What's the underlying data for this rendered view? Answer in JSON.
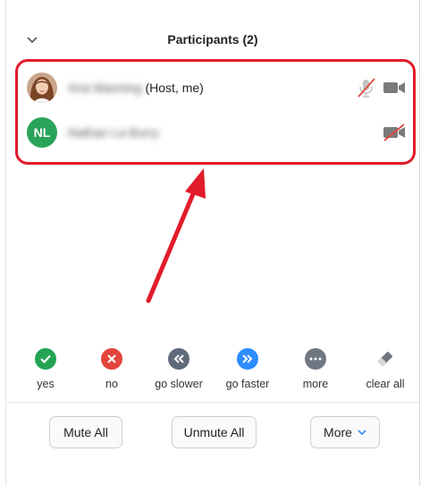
{
  "header": {
    "title": "Participants (2)"
  },
  "participants": [
    {
      "name": "Aria Manning",
      "suffix": "(Host, me)",
      "avatar": "photo"
    },
    {
      "name": "Nathan La Burry",
      "suffix": "",
      "initials": "NL",
      "avatar_color": "#2aa35a"
    }
  ],
  "reactions": [
    {
      "label": "yes",
      "color": "#23a455",
      "icon": "check-icon"
    },
    {
      "label": "no",
      "color": "#e2463c",
      "icon": "x-icon"
    },
    {
      "label": "go slower",
      "color": "#5f6b7a",
      "icon": "rewind-icon"
    },
    {
      "label": "go faster",
      "color": "#2d8cff",
      "icon": "fast-forward-icon"
    },
    {
      "label": "more",
      "color": "#6f7783",
      "icon": "ellipsis-icon"
    },
    {
      "label": "clear all",
      "color": "#6f7783",
      "icon": "eraser-icon"
    }
  ],
  "actions": {
    "mute_all": "Mute All",
    "unmute_all": "Unmute All",
    "more": "More"
  },
  "colors": {
    "highlight": "#e21b2a",
    "accent": "#2d8cff"
  }
}
